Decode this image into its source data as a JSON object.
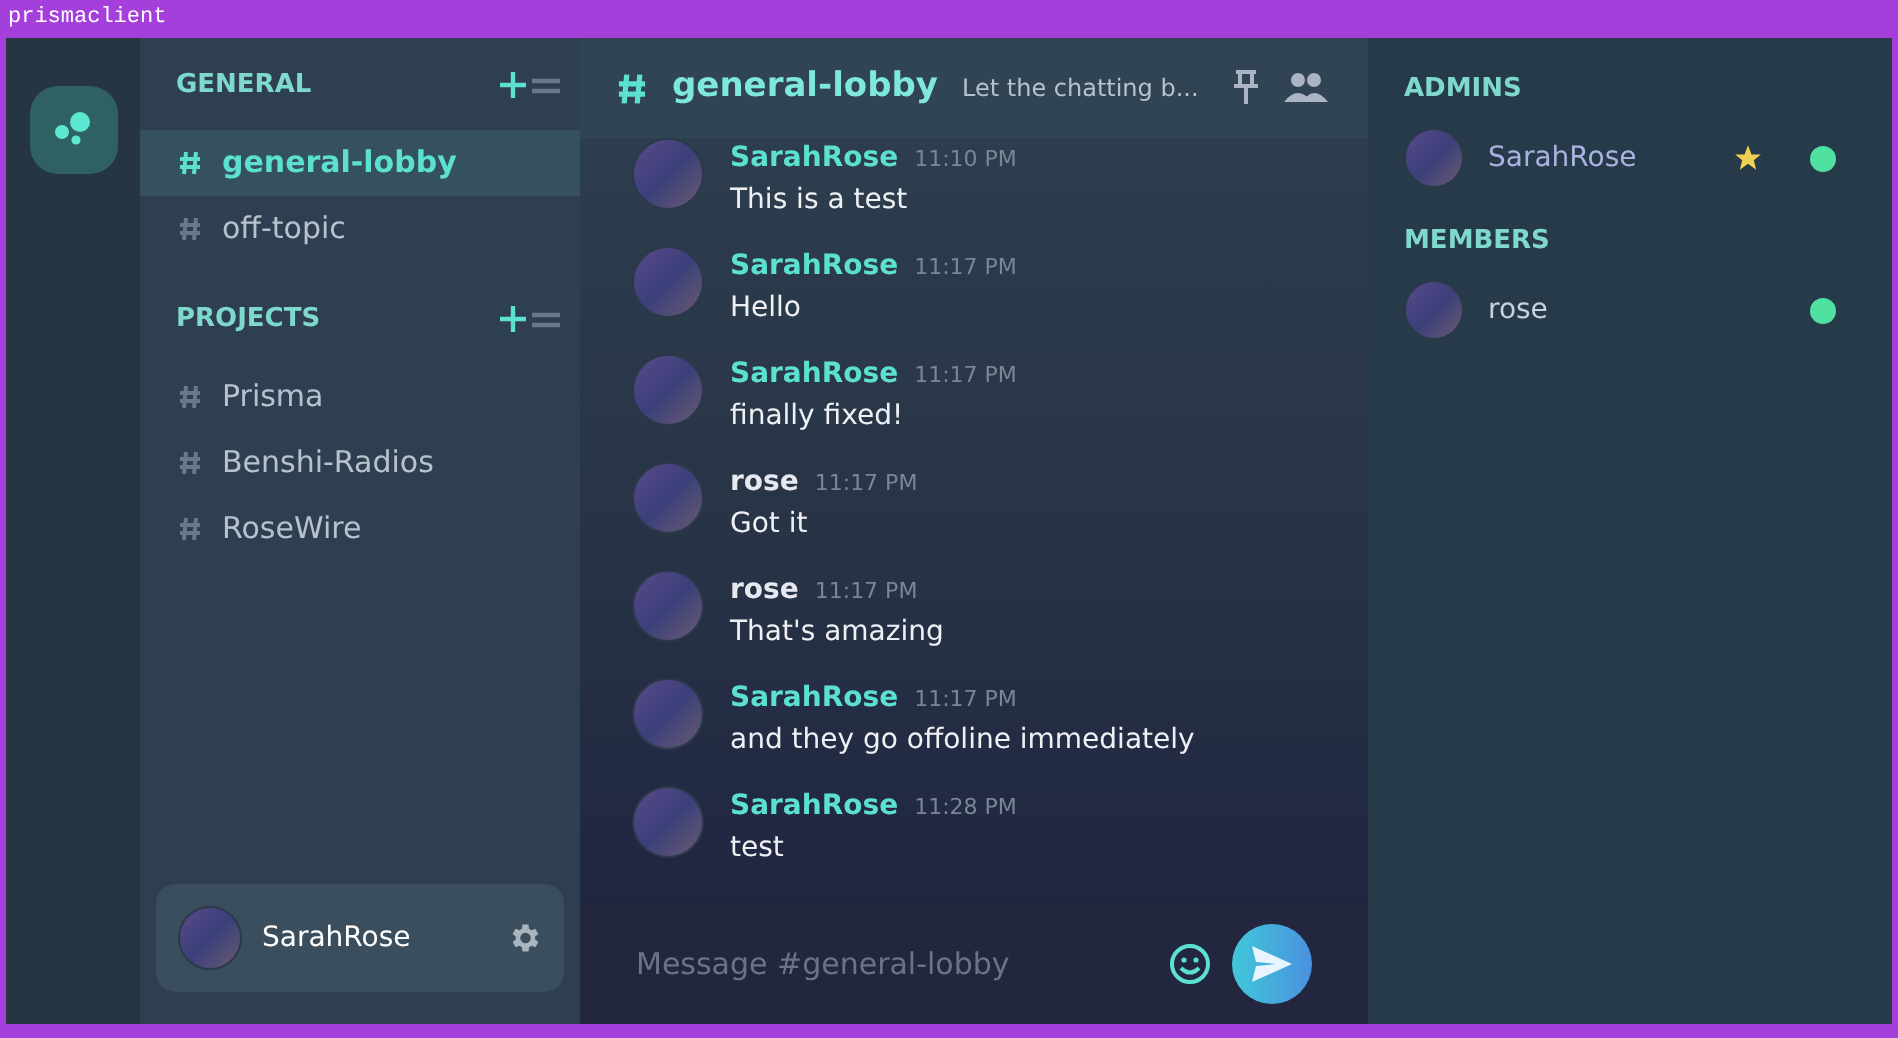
{
  "window": {
    "title": "prismaclient"
  },
  "sections": [
    {
      "title": "GENERAL",
      "channels": [
        {
          "name": "general-lobby",
          "selected": true
        },
        {
          "name": "off-topic",
          "selected": false
        }
      ]
    },
    {
      "title": "PROJECTS",
      "channels": [
        {
          "name": "Prisma",
          "selected": false
        },
        {
          "name": "Benshi-Radios",
          "selected": false
        },
        {
          "name": "RoseWire",
          "selected": false
        }
      ]
    }
  ],
  "user": {
    "name": "SarahRose"
  },
  "header": {
    "channel": "general-lobby",
    "topic": "Let the chatting b..."
  },
  "messages": [
    {
      "author": "SarahRose",
      "time": "11:10 PM",
      "text": "This is a test"
    },
    {
      "author": "SarahRose",
      "time": "11:17 PM",
      "text": "Hello"
    },
    {
      "author": "SarahRose",
      "time": "11:17 PM",
      "text": "finally fixed!"
    },
    {
      "author": "rose",
      "time": "11:17 PM",
      "text": "Got it"
    },
    {
      "author": "rose",
      "time": "11:17 PM",
      "text": "That's amazing"
    },
    {
      "author": "SarahRose",
      "time": "11:17 PM",
      "text": "and they go offoline immediately"
    },
    {
      "author": "SarahRose",
      "time": "11:28 PM",
      "text": "test"
    }
  ],
  "composer": {
    "placeholder": "Message #general-lobby"
  },
  "member_groups": [
    {
      "title": "ADMINS",
      "members": [
        {
          "name": "SarahRose",
          "admin": true,
          "online": true
        }
      ]
    },
    {
      "title": "MEMBERS",
      "members": [
        {
          "name": "rose",
          "admin": false,
          "online": true
        }
      ]
    }
  ]
}
